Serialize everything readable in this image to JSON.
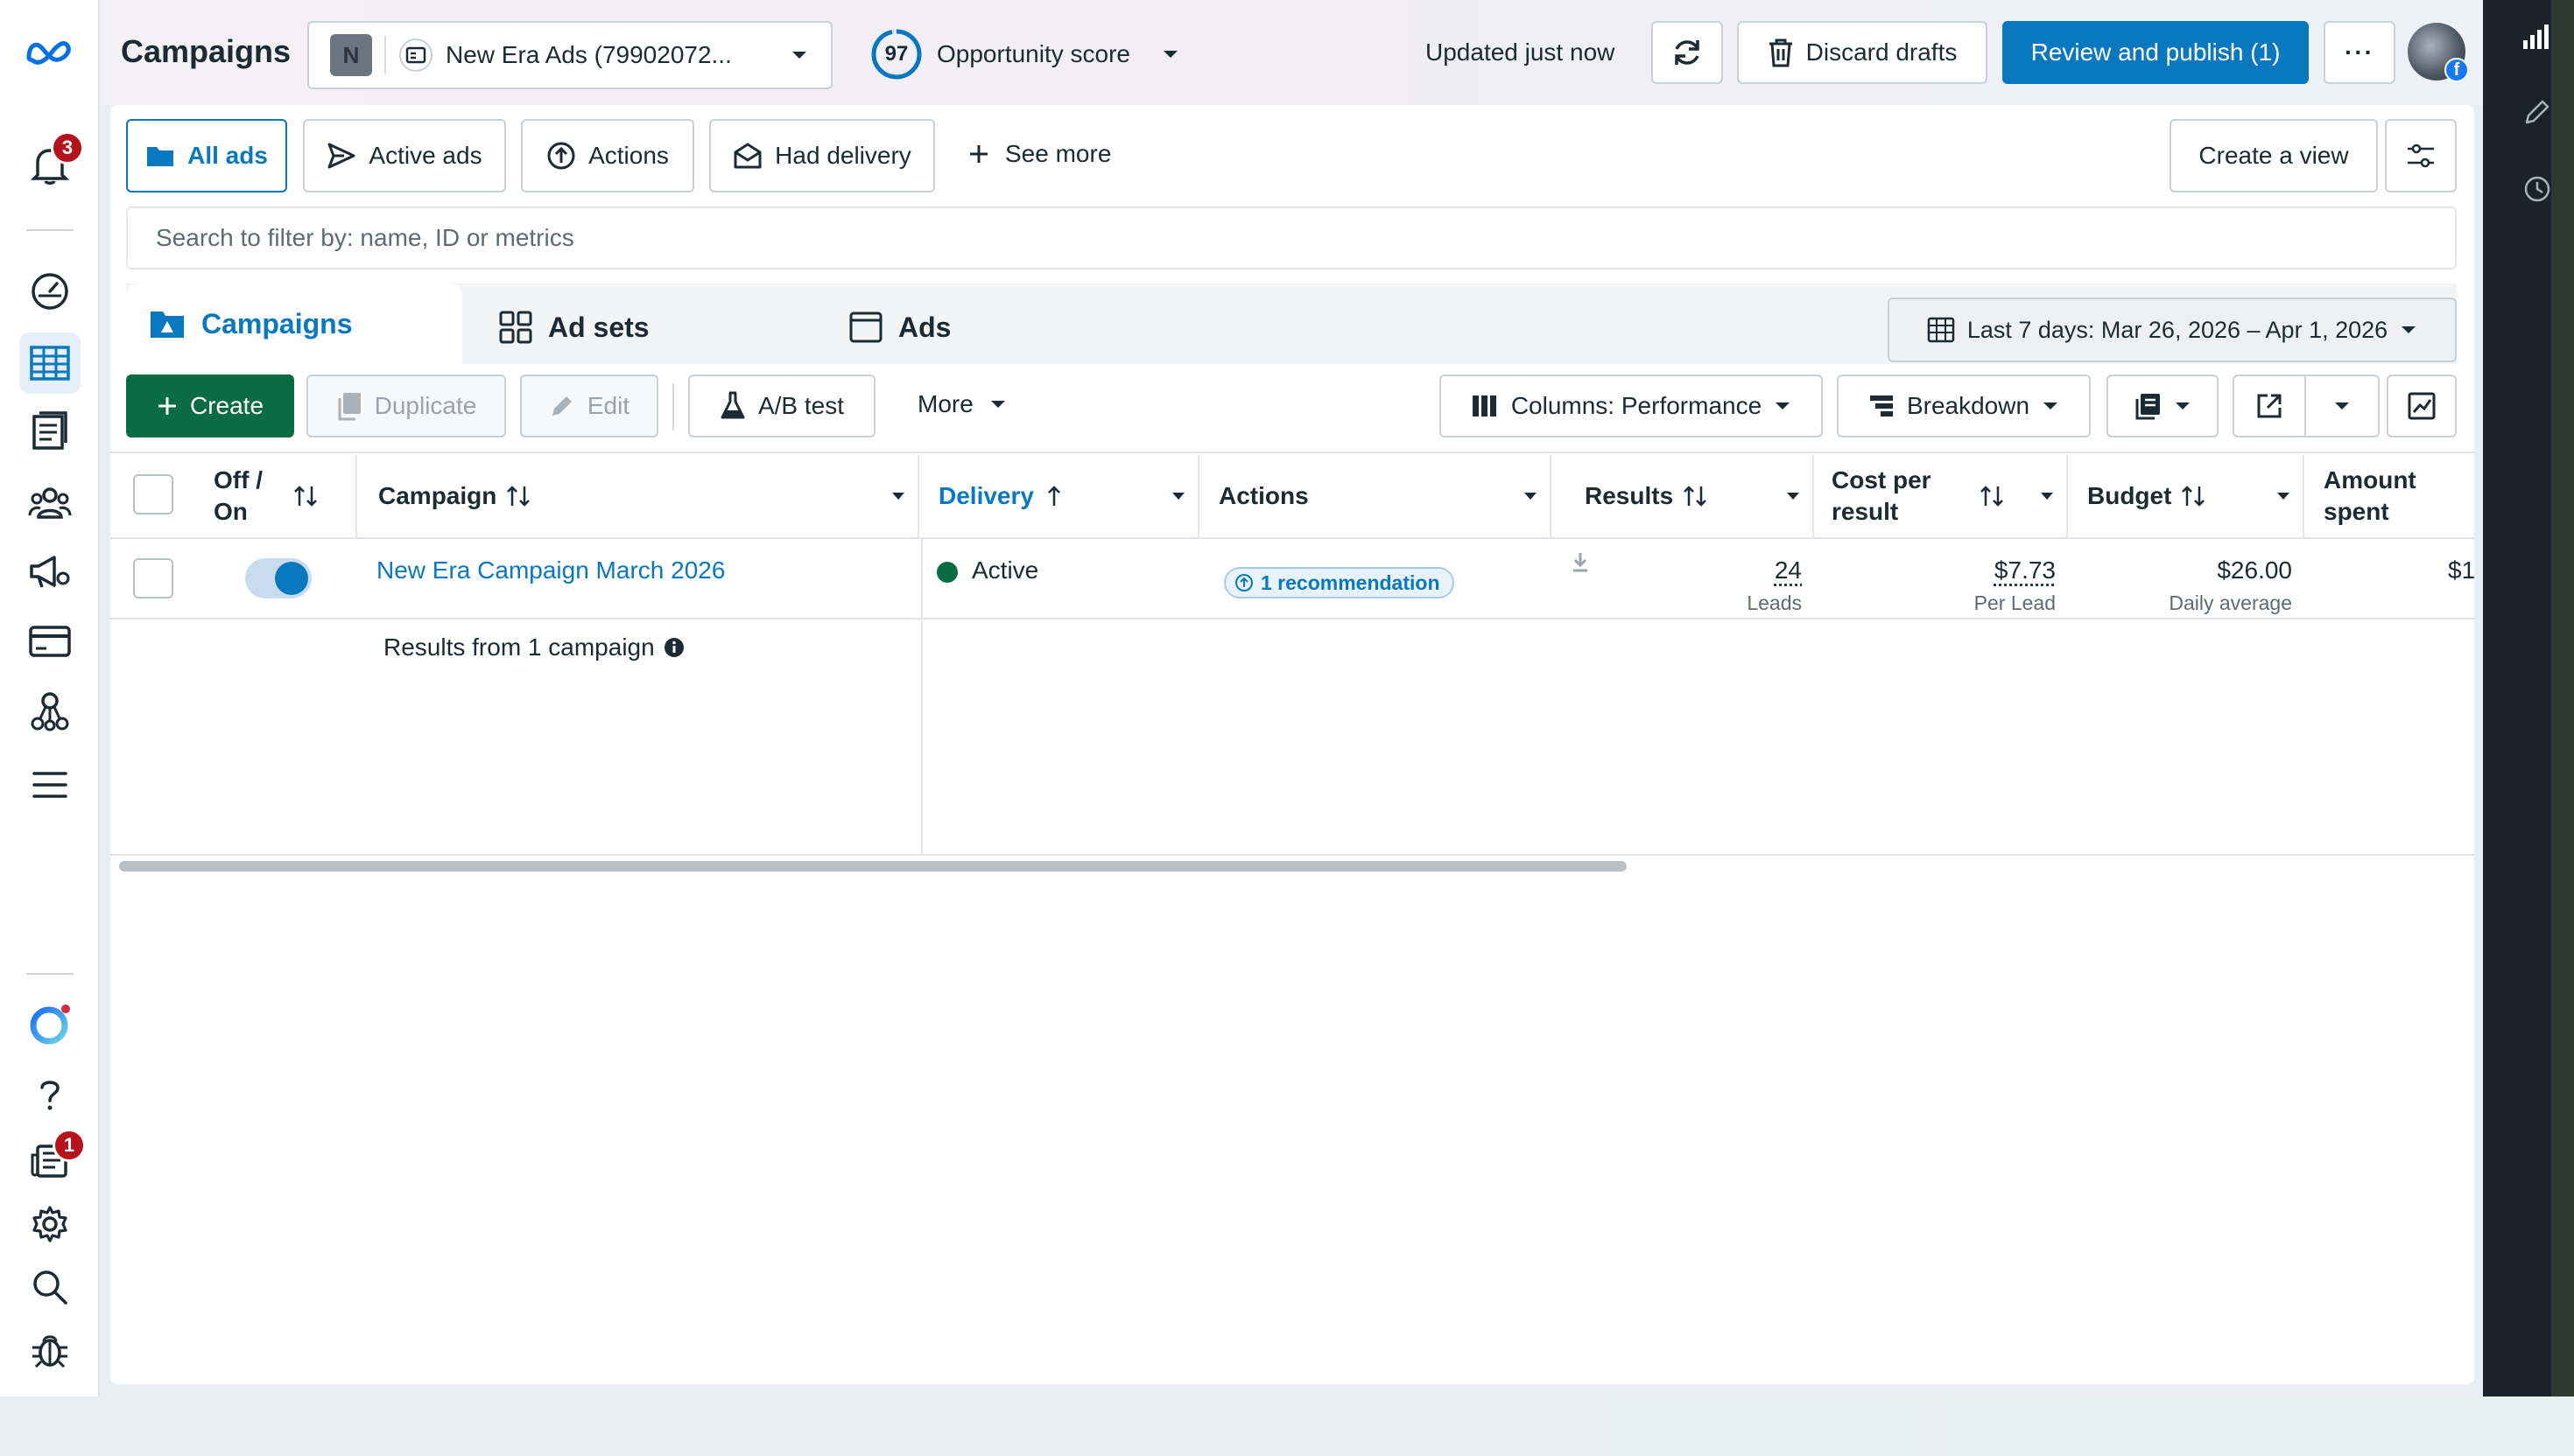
{
  "header": {
    "title": "Campaigns",
    "account_initial": "N",
    "account_name": "New Era Ads (79902072...",
    "opportunity_score": "97",
    "opportunity_label": "Opportunity score",
    "updated_text": "Updated just now",
    "discard_label": "Discard drafts",
    "publish_label": "Review and publish (1)",
    "more_label": "···"
  },
  "nav": {
    "notifications_badge": "3",
    "inbox_badge": "1"
  },
  "views": {
    "tabs": [
      {
        "label": "All ads"
      },
      {
        "label": "Active ads"
      },
      {
        "label": "Actions"
      },
      {
        "label": "Had delivery"
      },
      {
        "label": "See more"
      }
    ],
    "create_view_label": "Create a view"
  },
  "search": {
    "placeholder": "Search to filter by: name, ID or metrics"
  },
  "levels": {
    "tabs": [
      {
        "label": "Campaigns"
      },
      {
        "label": "Ad sets"
      },
      {
        "label": "Ads"
      }
    ],
    "date_range": "Last 7 days: Mar 26, 2026 – Apr 1, 2026"
  },
  "toolbar": {
    "create_label": "Create",
    "duplicate_label": "Duplicate",
    "edit_label": "Edit",
    "ab_test_label": "A/B test",
    "more_label": "More",
    "columns_label": "Columns: Performance",
    "breakdown_label": "Breakdown"
  },
  "table": {
    "headers": {
      "off_on": "Off / On",
      "campaign": "Campaign",
      "delivery": "Delivery",
      "actions": "Actions",
      "results": "Results",
      "cost_per_result": "Cost per result",
      "budget": "Budget",
      "amount_spent": "Amount spent"
    },
    "rows": [
      {
        "name": "New Era Campaign March 2026",
        "delivery": "Active",
        "recommendation": "1 recommendation",
        "results": "24",
        "results_sub": "Leads",
        "cost": "$7.73",
        "cost_sub": "Per Lead",
        "budget": "$26.00",
        "budget_sub": "Daily average",
        "amount_spent": "$1"
      }
    ],
    "summary": "Results from 1 campaign"
  },
  "colors": {
    "accent": "#0a78be",
    "create_green": "#0b6b45",
    "active_dot": "#0b6b45",
    "badge_red": "#b5121b"
  }
}
